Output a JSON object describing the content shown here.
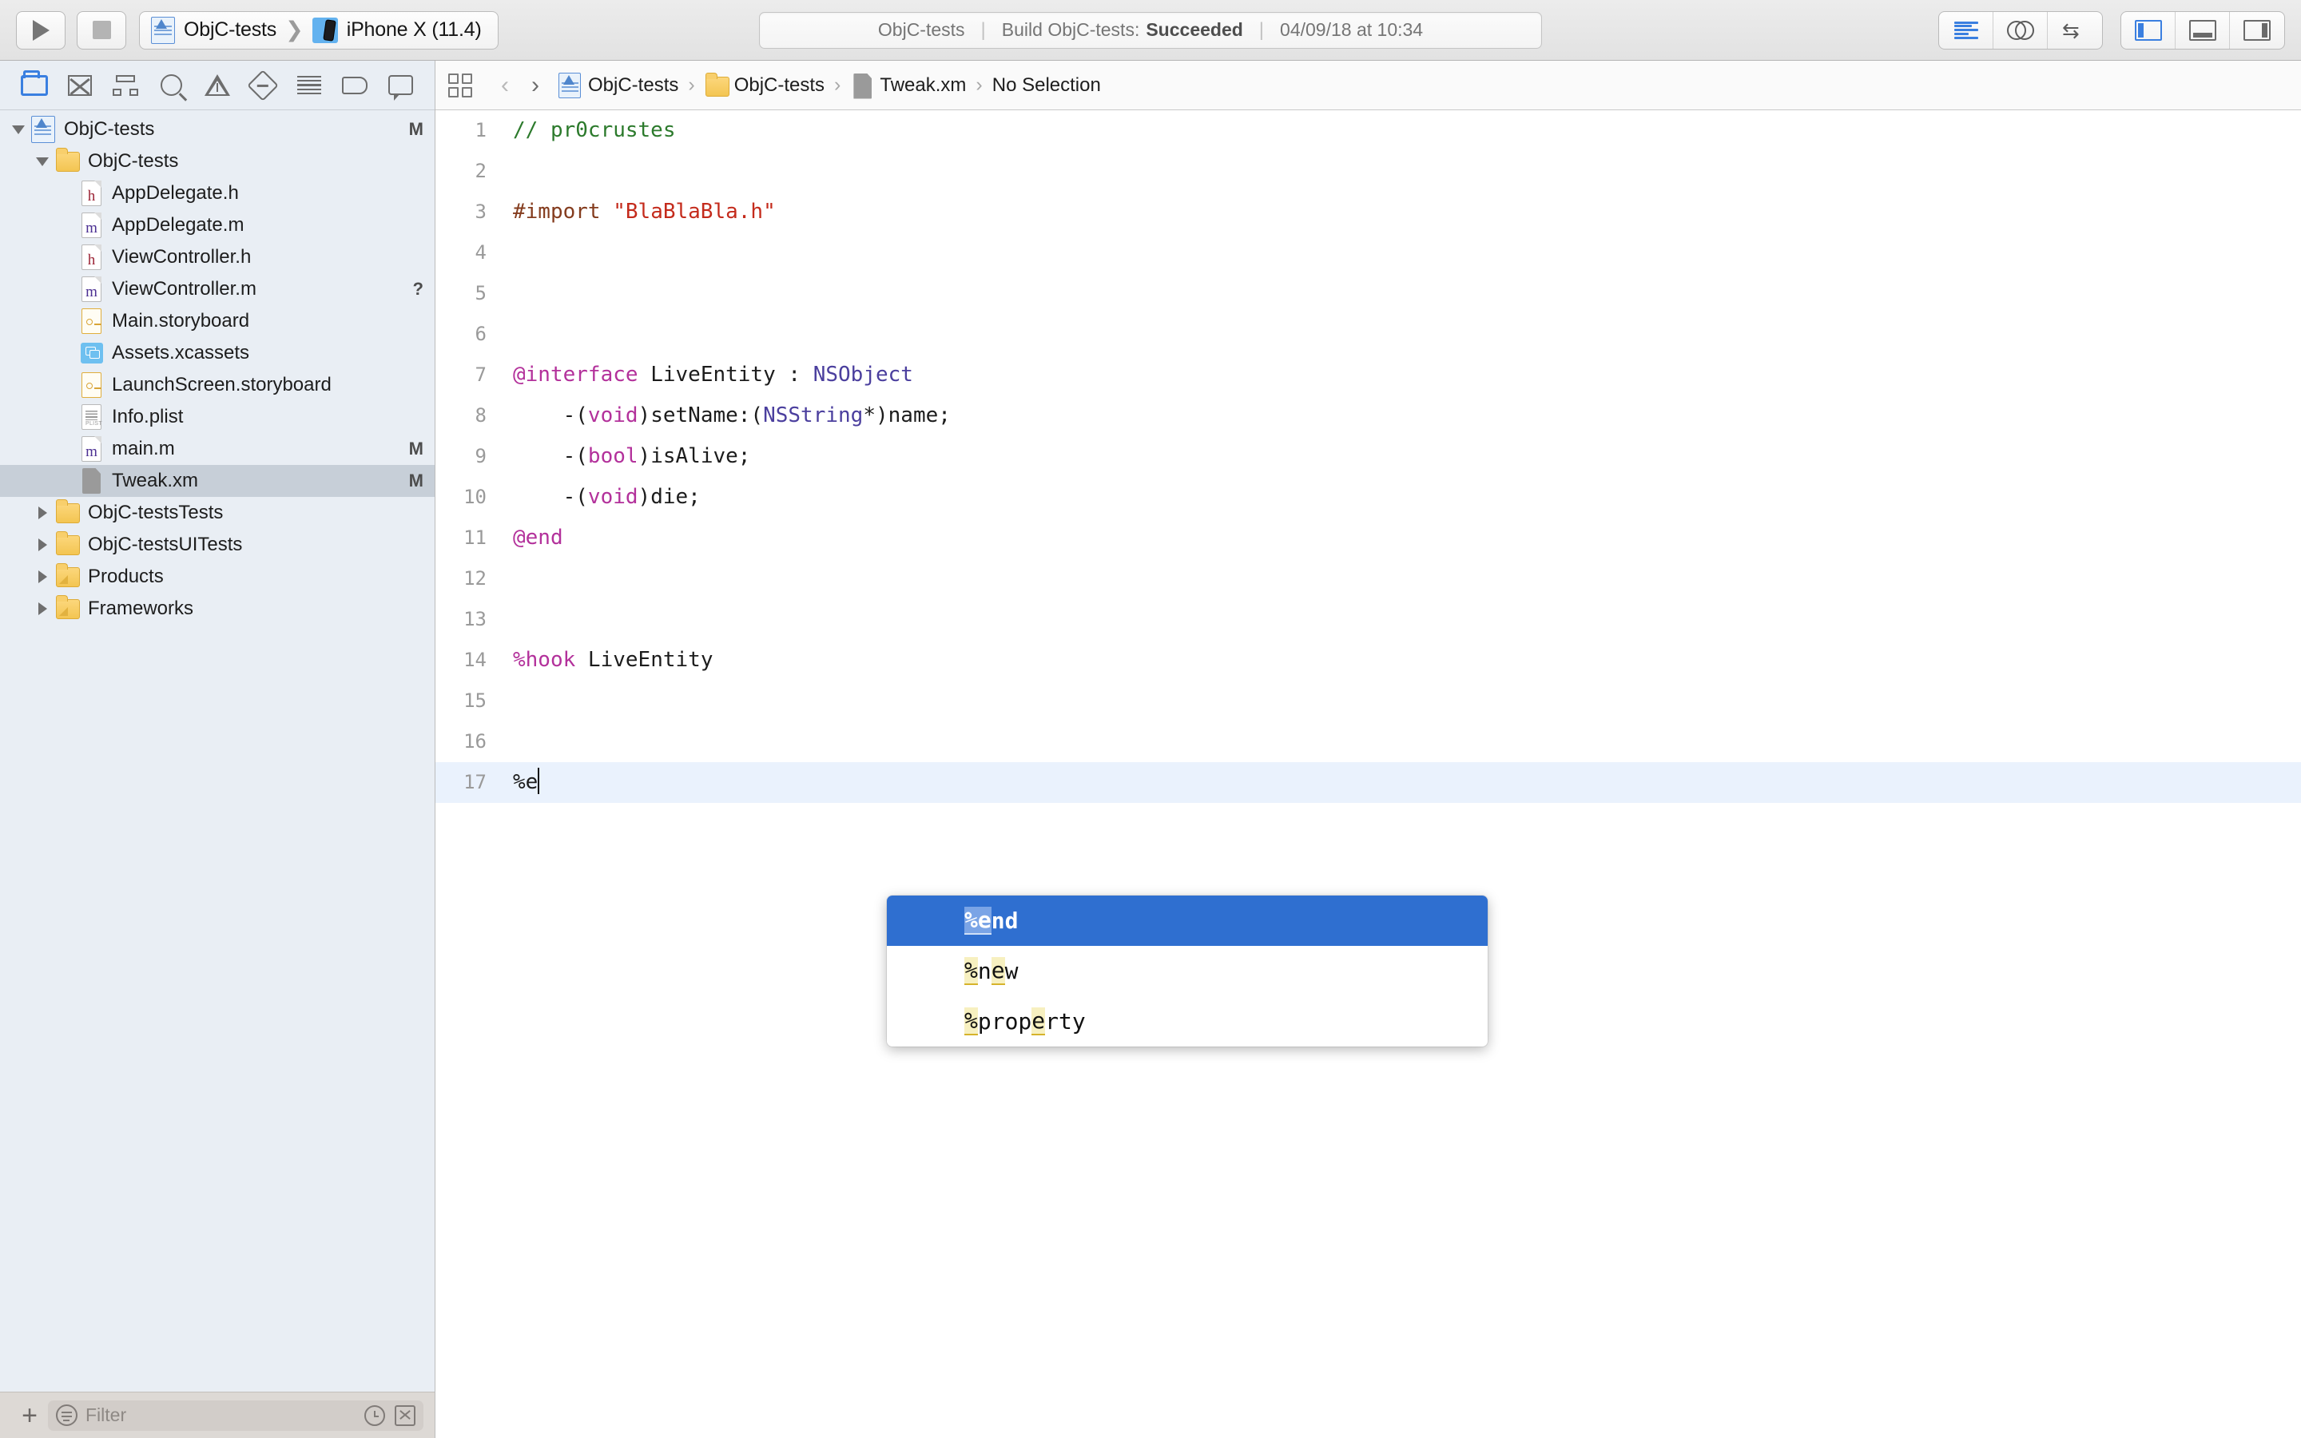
{
  "toolbar": {
    "run_label": "Run",
    "stop_label": "Stop",
    "scheme_name": "ObjC-tests",
    "destination_name": "iPhone X (11.4)",
    "status": {
      "project": "ObjC-tests",
      "build_text": "Build ObjC-tests:",
      "build_result": "Succeeded",
      "timestamp": "04/09/18 at 10:34",
      "separator": "|"
    },
    "editor_modes": [
      {
        "name": "standard-editor",
        "active": true
      },
      {
        "name": "assistant-editor",
        "active": false
      },
      {
        "name": "version-editor",
        "active": false
      }
    ],
    "view_toggles": [
      {
        "name": "navigator",
        "active": true
      },
      {
        "name": "debug-area",
        "active": false
      },
      {
        "name": "inspector",
        "active": false
      }
    ]
  },
  "navigator": {
    "tabs": [
      {
        "name": "project-navigator",
        "active": true
      },
      {
        "name": "source-control-navigator",
        "active": false
      },
      {
        "name": "symbol-navigator",
        "active": false
      },
      {
        "name": "find-navigator",
        "active": false
      },
      {
        "name": "issue-navigator",
        "active": false
      },
      {
        "name": "test-navigator",
        "active": false
      },
      {
        "name": "debug-navigator",
        "active": false
      },
      {
        "name": "breakpoint-navigator",
        "active": false
      },
      {
        "name": "report-navigator",
        "active": false
      }
    ],
    "items": [
      {
        "label": "ObjC-tests",
        "icon": "xcodeproj",
        "indent": 0,
        "twisty": "down",
        "mark": "M",
        "selected": false
      },
      {
        "label": "ObjC-tests",
        "icon": "folder",
        "indent": 1,
        "twisty": "down",
        "mark": "",
        "selected": false
      },
      {
        "label": "AppDelegate.h",
        "icon": "header",
        "indent": 2,
        "twisty": "none",
        "mark": "",
        "selected": false
      },
      {
        "label": "AppDelegate.m",
        "icon": "impl",
        "indent": 2,
        "twisty": "none",
        "mark": "",
        "selected": false
      },
      {
        "label": "ViewController.h",
        "icon": "header",
        "indent": 2,
        "twisty": "none",
        "mark": "",
        "selected": false
      },
      {
        "label": "ViewController.m",
        "icon": "impl",
        "indent": 2,
        "twisty": "none",
        "mark": "?",
        "selected": false
      },
      {
        "label": "Main.storyboard",
        "icon": "storyboard",
        "indent": 2,
        "twisty": "none",
        "mark": "",
        "selected": false
      },
      {
        "label": "Assets.xcassets",
        "icon": "xcassets",
        "indent": 2,
        "twisty": "none",
        "mark": "",
        "selected": false
      },
      {
        "label": "LaunchScreen.storyboard",
        "icon": "storyboard",
        "indent": 2,
        "twisty": "none",
        "mark": "",
        "selected": false
      },
      {
        "label": "Info.plist",
        "icon": "plist",
        "indent": 2,
        "twisty": "none",
        "mark": "",
        "selected": false
      },
      {
        "label": "main.m",
        "icon": "impl",
        "indent": 2,
        "twisty": "none",
        "mark": "M",
        "selected": false
      },
      {
        "label": "Tweak.xm",
        "icon": "generic",
        "indent": 2,
        "twisty": "none",
        "mark": "M",
        "selected": true
      },
      {
        "label": "ObjC-testsTests",
        "icon": "folder",
        "indent": 1,
        "twisty": "right",
        "mark": "",
        "selected": false
      },
      {
        "label": "ObjC-testsUITests",
        "icon": "folder",
        "indent": 1,
        "twisty": "right",
        "mark": "",
        "selected": false
      },
      {
        "label": "Products",
        "icon": "folder-alt",
        "indent": 1,
        "twisty": "right",
        "mark": "",
        "selected": false
      },
      {
        "label": "Frameworks",
        "icon": "folder-alt",
        "indent": 1,
        "twisty": "right",
        "mark": "",
        "selected": false
      }
    ],
    "footer": {
      "add_label": "+",
      "filter_placeholder": "Filter"
    }
  },
  "jumpbar": {
    "back_label": "‹",
    "forward_label": "›",
    "breadcrumb": [
      {
        "label": "ObjC-tests",
        "icon": "xcodeproj"
      },
      {
        "label": "ObjC-tests",
        "icon": "folder"
      },
      {
        "label": "Tweak.xm",
        "icon": "generic"
      },
      {
        "label": "No Selection",
        "icon": "none"
      }
    ],
    "separator": "›"
  },
  "editor": {
    "filename": "Tweak.xm",
    "current_line": 17,
    "lines": [
      {
        "n": 1,
        "tokens": [
          {
            "t": "// pr0crustes",
            "c": "cm"
          }
        ]
      },
      {
        "n": 2,
        "tokens": []
      },
      {
        "n": 3,
        "tokens": [
          {
            "t": "#import ",
            "c": "pp"
          },
          {
            "t": "\"BlaBlaBla.h\"",
            "c": "str"
          }
        ]
      },
      {
        "n": 4,
        "tokens": []
      },
      {
        "n": 5,
        "tokens": []
      },
      {
        "n": 6,
        "tokens": []
      },
      {
        "n": 7,
        "tokens": [
          {
            "t": "@interface",
            "c": "kw"
          },
          {
            "t": " LiveEntity : ",
            "c": ""
          },
          {
            "t": "NSObject",
            "c": "cls"
          }
        ]
      },
      {
        "n": 8,
        "tokens": [
          {
            "t": "    -(",
            "c": ""
          },
          {
            "t": "void",
            "c": "kw"
          },
          {
            "t": ")setName:(",
            "c": ""
          },
          {
            "t": "NSString",
            "c": "cls"
          },
          {
            "t": "*)name;",
            "c": ""
          }
        ]
      },
      {
        "n": 9,
        "tokens": [
          {
            "t": "    -(",
            "c": ""
          },
          {
            "t": "bool",
            "c": "kw"
          },
          {
            "t": ")isAlive;",
            "c": ""
          }
        ]
      },
      {
        "n": 10,
        "tokens": [
          {
            "t": "    -(",
            "c": ""
          },
          {
            "t": "void",
            "c": "kw"
          },
          {
            "t": ")die;",
            "c": ""
          }
        ]
      },
      {
        "n": 11,
        "tokens": [
          {
            "t": "@end",
            "c": "kw"
          }
        ]
      },
      {
        "n": 12,
        "tokens": []
      },
      {
        "n": 13,
        "tokens": []
      },
      {
        "n": 14,
        "tokens": [
          {
            "t": "%hook",
            "c": "kw"
          },
          {
            "t": " LiveEntity",
            "c": ""
          }
        ]
      },
      {
        "n": 15,
        "tokens": []
      },
      {
        "n": 16,
        "tokens": []
      },
      {
        "n": 17,
        "tokens": [
          {
            "t": "%e",
            "c": ""
          }
        ],
        "cursor": true
      }
    ]
  },
  "autocomplete": {
    "query": "%e",
    "suggestions": [
      {
        "text": "%end",
        "parts": [
          {
            "t": "%e",
            "hl": true
          },
          {
            "t": "nd",
            "hl": false
          }
        ],
        "selected": true
      },
      {
        "text": "%new",
        "parts": [
          {
            "t": "%",
            "hl": true
          },
          {
            "t": "n",
            "hl": false
          },
          {
            "t": "e",
            "hl": true
          },
          {
            "t": "w",
            "hl": false
          }
        ],
        "selected": false
      },
      {
        "text": "%property",
        "parts": [
          {
            "t": "%",
            "hl": true
          },
          {
            "t": "prop",
            "hl": false
          },
          {
            "t": "e",
            "hl": true
          },
          {
            "t": "rty",
            "hl": false
          }
        ],
        "selected": false
      }
    ]
  },
  "colors": {
    "accent": "#3a7fe0",
    "selection_blue": "#2f6fd0",
    "comment_green": "#2c7a2c",
    "string_red": "#c42b1c",
    "keyword_magenta": "#b3319b",
    "class_purple": "#4b3f9e",
    "preprocessor_brown": "#843c1e",
    "navigator_bg": "#e9eef4",
    "row_selected": "#c7cfd8",
    "current_line": "#eaf2fd",
    "match_highlight": "#f7f0c0"
  }
}
